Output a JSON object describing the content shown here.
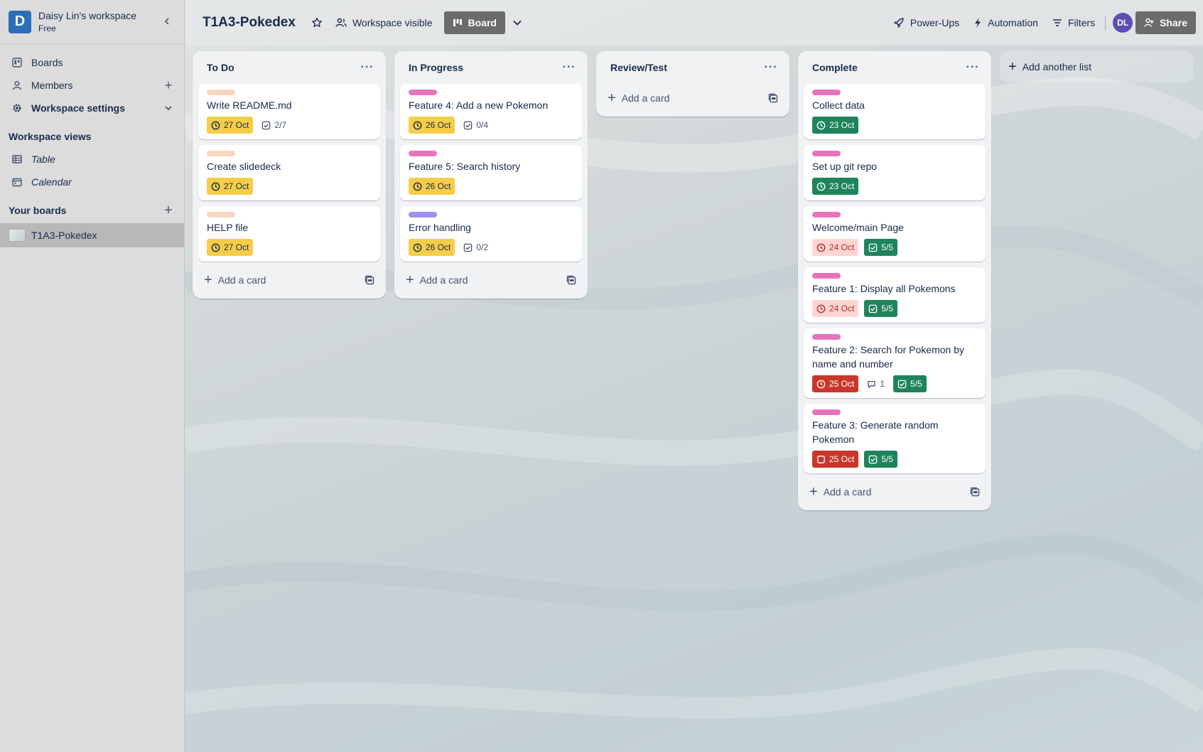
{
  "workspace": {
    "initial": "D",
    "name": "Daisy Lin's workspace",
    "plan": "Free"
  },
  "sidebar": {
    "items": [
      {
        "label": "Boards"
      },
      {
        "label": "Members"
      },
      {
        "label": "Workspace settings"
      }
    ],
    "views_title": "Workspace views",
    "views": [
      {
        "label": "Table"
      },
      {
        "label": "Calendar"
      }
    ],
    "boards_title": "Your boards",
    "boards": [
      {
        "label": "T1A3-Pokedex"
      }
    ]
  },
  "topbar": {
    "board_title": "T1A3-Pokedex",
    "visibility": "Workspace visible",
    "view": "Board",
    "powerups": "Power-Ups",
    "automation": "Automation",
    "filters": "Filters",
    "avatar": "DL",
    "share": "Share"
  },
  "colors": {
    "label_peach": "#f9d6bf",
    "label_pink": "#e774bb",
    "label_purple": "#9f8fef",
    "badge_yellow": "#f5cd47",
    "badge_green": "#1f845a",
    "badge_red": "#c9372c"
  },
  "lists": [
    {
      "title": "To Do",
      "add_card": "Add a card",
      "cards": [
        {
          "title": "Write README.md",
          "due": "27 Oct",
          "checklist": "2/7"
        },
        {
          "title": "Create slidedeck",
          "due": "27 Oct"
        },
        {
          "title": "HELP file",
          "due": "27 Oct"
        }
      ]
    },
    {
      "title": "In Progress",
      "add_card": "Add a card",
      "cards": [
        {
          "title": "Feature 4: Add a new Pokemon",
          "due": "26 Oct",
          "checklist": "0/4"
        },
        {
          "title": "Feature 5: Search history",
          "due": "26 Oct"
        },
        {
          "title": "Error handling",
          "due": "26 Oct",
          "checklist": "0/2"
        }
      ]
    },
    {
      "title": "Review/Test",
      "add_card": "Add a card",
      "cards": []
    },
    {
      "title": "Complete",
      "add_card": "Add a card",
      "cards": [
        {
          "title": "Collect data",
          "due": "23 Oct"
        },
        {
          "title": "Set up git repo",
          "due": "23 Oct"
        },
        {
          "title": "Welcome/main Page",
          "due": "24 Oct",
          "checklist": "5/5"
        },
        {
          "title": "Feature 1: Display all Pokemons",
          "due": "24 Oct",
          "checklist": "5/5"
        },
        {
          "title": "Feature 2: Search for Pokemon by name and number",
          "due": "25 Oct",
          "comments": "1",
          "checklist": "5/5"
        },
        {
          "title": "Feature 3: Generate random Pokemon",
          "due": "25 Oct",
          "checklist": "5/5"
        }
      ]
    }
  ],
  "add_list": "Add another list"
}
